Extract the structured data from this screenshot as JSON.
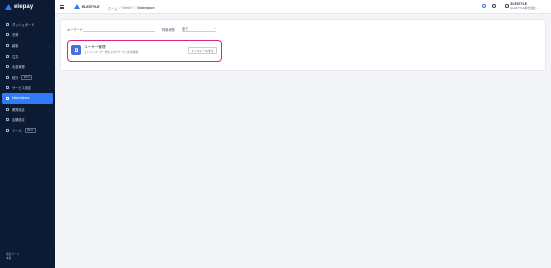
{
  "app": {
    "logo": "elepay"
  },
  "sidebar": {
    "items": [
      {
        "label": "ダッシュボード",
        "icon": "dashboard-icon",
        "chevron": false,
        "tag": ""
      },
      {
        "label": "決済",
        "icon": "payment-icon",
        "chevron": false,
        "tag": ""
      },
      {
        "label": "顧客",
        "icon": "customer-icon",
        "chevron": true,
        "tag": ""
      },
      {
        "label": "注文",
        "icon": "order-icon",
        "chevron": false,
        "tag": ""
      },
      {
        "label": "出金管理",
        "icon": "withdrawal-icon",
        "chevron": true,
        "tag": ""
      },
      {
        "label": "統計",
        "icon": "stats-icon",
        "chevron": false,
        "tag": "BETA"
      },
      {
        "label": "サービス設定",
        "icon": "service-icon",
        "chevron": true,
        "tag": ""
      },
      {
        "label": "Marketplace",
        "icon": "marketplace-icon",
        "chevron": false,
        "tag": "",
        "active": true
      },
      {
        "label": "開発設定",
        "icon": "developer-icon",
        "chevron": true,
        "tag": ""
      },
      {
        "label": "店舗設定",
        "icon": "store-icon",
        "chevron": false,
        "tag": ""
      },
      {
        "label": "ツール",
        "icon": "tool-icon",
        "chevron": false,
        "tag": "BETA"
      }
    ],
    "footer": {
      "line1": "環境モード",
      "line2": "本番"
    }
  },
  "header": {
    "org_name": "ELESTYLE",
    "breadcrumb": [
      "ホーム",
      "ElestYl",
      "Marketplace"
    ],
    "user_name": "ELESTYLE",
    "user_sub": "ELESTYLE株式会社..."
  },
  "filters": {
    "keyword_label": "キーワード",
    "keyword_placeholder": "",
    "status_label": "利用状態",
    "status_value": "全て"
  },
  "apps": [
    {
      "name": "ユーザー管理",
      "description": "エレペイユーザー登録されずサービス利用機能",
      "button": "インストールする"
    }
  ],
  "colors": {
    "sidebar_bg": "#0c1a33",
    "accent": "#2f7cf6",
    "highlight_border": "#e0247a"
  }
}
